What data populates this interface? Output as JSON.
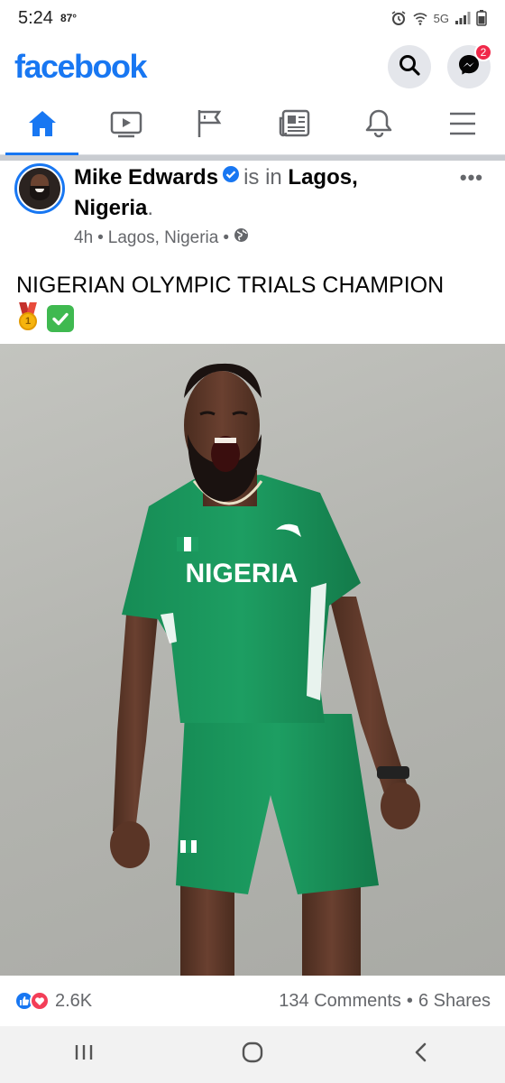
{
  "status_bar": {
    "time": "5:24",
    "temperature": "87°",
    "network": "5G",
    "icons": [
      "alarm-icon",
      "wifi-icon",
      "signal-icon",
      "battery-icon"
    ]
  },
  "header": {
    "logo": "facebook",
    "brand_color": "#1877f2",
    "messenger_badge": "2"
  },
  "nav": {
    "tabs": [
      {
        "name": "home",
        "icon": "home-icon",
        "active": true
      },
      {
        "name": "watch",
        "icon": "video-icon",
        "active": false
      },
      {
        "name": "pages",
        "icon": "flag-icon",
        "active": false
      },
      {
        "name": "news",
        "icon": "newspaper-icon",
        "active": false
      },
      {
        "name": "notifications",
        "icon": "bell-icon",
        "active": false
      },
      {
        "name": "menu",
        "icon": "menu-icon",
        "active": false
      }
    ]
  },
  "post": {
    "author": "Mike Edwards",
    "is_in": "is in",
    "place": "Lagos, Nigeria",
    "time": "4h",
    "location": "Lagos, Nigeria",
    "privacy_icon": "globe-icon",
    "text": "NIGERIAN OLYMPIC TRIALS CHAMPION",
    "emojis": [
      "medal-icon",
      "check-mark-icon"
    ],
    "jersey_text": "NIGERIA"
  },
  "reactions": {
    "count": "2.6K",
    "comments": "134 Comments",
    "separator": "•",
    "shares": "6 Shares",
    "icons": [
      "like-icon",
      "love-icon"
    ]
  },
  "system_nav": {
    "buttons": [
      "recent-apps-icon",
      "home-circle-icon",
      "back-icon"
    ]
  }
}
